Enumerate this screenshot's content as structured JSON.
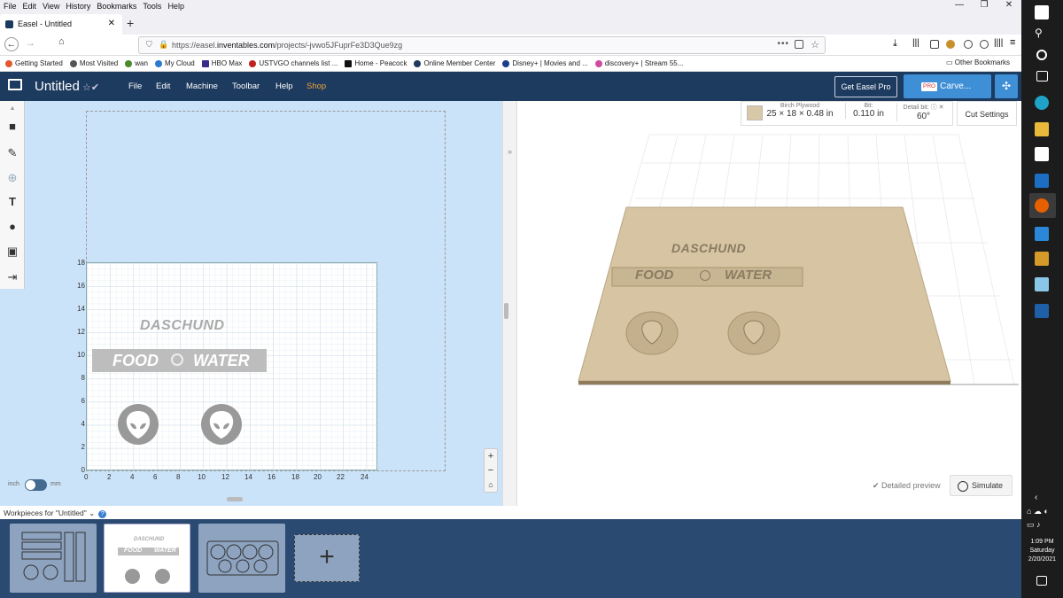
{
  "browser": {
    "menu": [
      "File",
      "Edit",
      "View",
      "History",
      "Bookmarks",
      "Tools",
      "Help"
    ],
    "tab_title": "Easel - Untitled",
    "url_prefix": "https://easel.",
    "url_domain": "inventables.com",
    "url_path": "/projects/-jvwo5JFuprFe3D3Que9zg",
    "bookmarks": [
      "Getting Started",
      "Most Visited",
      "wan",
      "My Cloud",
      "HBO Max",
      "USTVGO channels list ...",
      "Home - Peacock",
      "Online Member Center",
      "Disney+ | Movies and ...",
      "discovery+ | Stream 55..."
    ],
    "other_bookmarks": "Other Bookmarks"
  },
  "easel": {
    "title": "Untitled",
    "menu": [
      "File",
      "Edit",
      "Machine",
      "Toolbar",
      "Help",
      "Shop"
    ],
    "get_pro": "Get Easel Pro",
    "carve_badge": "PRO",
    "carve": "Carve...",
    "accent": "#3f8fd6",
    "header_bg": "#1d3a5f"
  },
  "canvas": {
    "y_ticks": [
      "18",
      "16",
      "14",
      "12",
      "10",
      "8",
      "6",
      "4",
      "2",
      "0"
    ],
    "x_ticks": [
      "0",
      "2",
      "4",
      "6",
      "8",
      "10",
      "12",
      "14",
      "16",
      "18",
      "20",
      "22",
      "24"
    ],
    "text_top": "DASCHUND",
    "text_food": "FOOD",
    "text_water": "WATER",
    "unit_inch": "inch",
    "unit_mm": "mm"
  },
  "material": {
    "name": "Birch Plywood",
    "size": "25 × 18 × 0.48 in",
    "bit_label": "Bit:",
    "bit_value": "0.110 in",
    "detail_label": "Detail bit:",
    "detail_value": "60°",
    "cut_settings": "Cut Settings"
  },
  "preview": {
    "detailed_preview": "Detailed preview",
    "simulate": "Simulate"
  },
  "workpieces": {
    "label": "Workpieces for \"Untitled\"",
    "thumb_text_top": "DASCHUND",
    "thumb_food": "FOOD",
    "thumb_water": "WATER"
  },
  "taskbar": {
    "time": "1:09 PM",
    "day": "Saturday",
    "date": "2/20/2021"
  }
}
